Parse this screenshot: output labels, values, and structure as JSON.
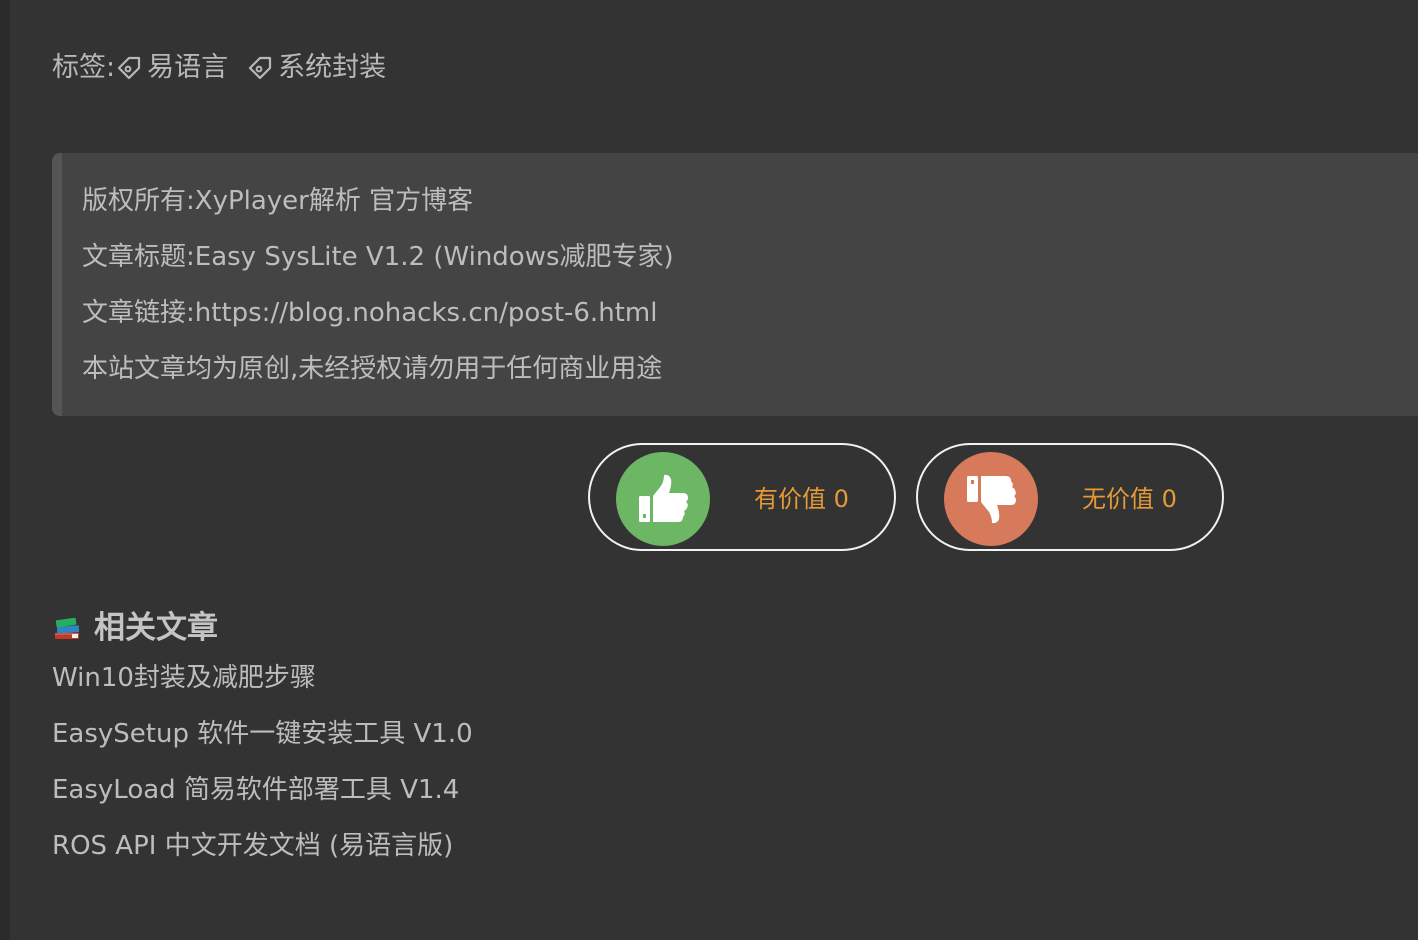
{
  "tags": {
    "label": "标签:",
    "items": [
      "易语言",
      "系统封装"
    ]
  },
  "copyright": {
    "owner_label": "版权所有:",
    "owner_value": "XyPlayer解析 官方博客",
    "title_label": "文章标题:",
    "title_value": "Easy SysLite V1.2 (Windows减肥专家)",
    "link_label": "文章链接:",
    "link_value": "https://blog.nohacks.cn/post-6.html",
    "notice": "本站文章均为原创,未经授权请勿用于任何商业用途"
  },
  "votes": {
    "up_label": "有价值",
    "up_count": "0",
    "down_label": "无价值",
    "down_count": "0",
    "up_color": "#6cb664",
    "down_color": "#d77a5c",
    "label_color": "#e59a36"
  },
  "related": {
    "icon": "books-icon",
    "title": "相关文章",
    "items": [
      "Win10封装及减肥步骤",
      "EasySetup 软件一键安装工具 V1.0",
      "EasyLoad 简易软件部署工具 V1.4",
      "ROS API 中文开发文档 (易语言版)"
    ]
  }
}
